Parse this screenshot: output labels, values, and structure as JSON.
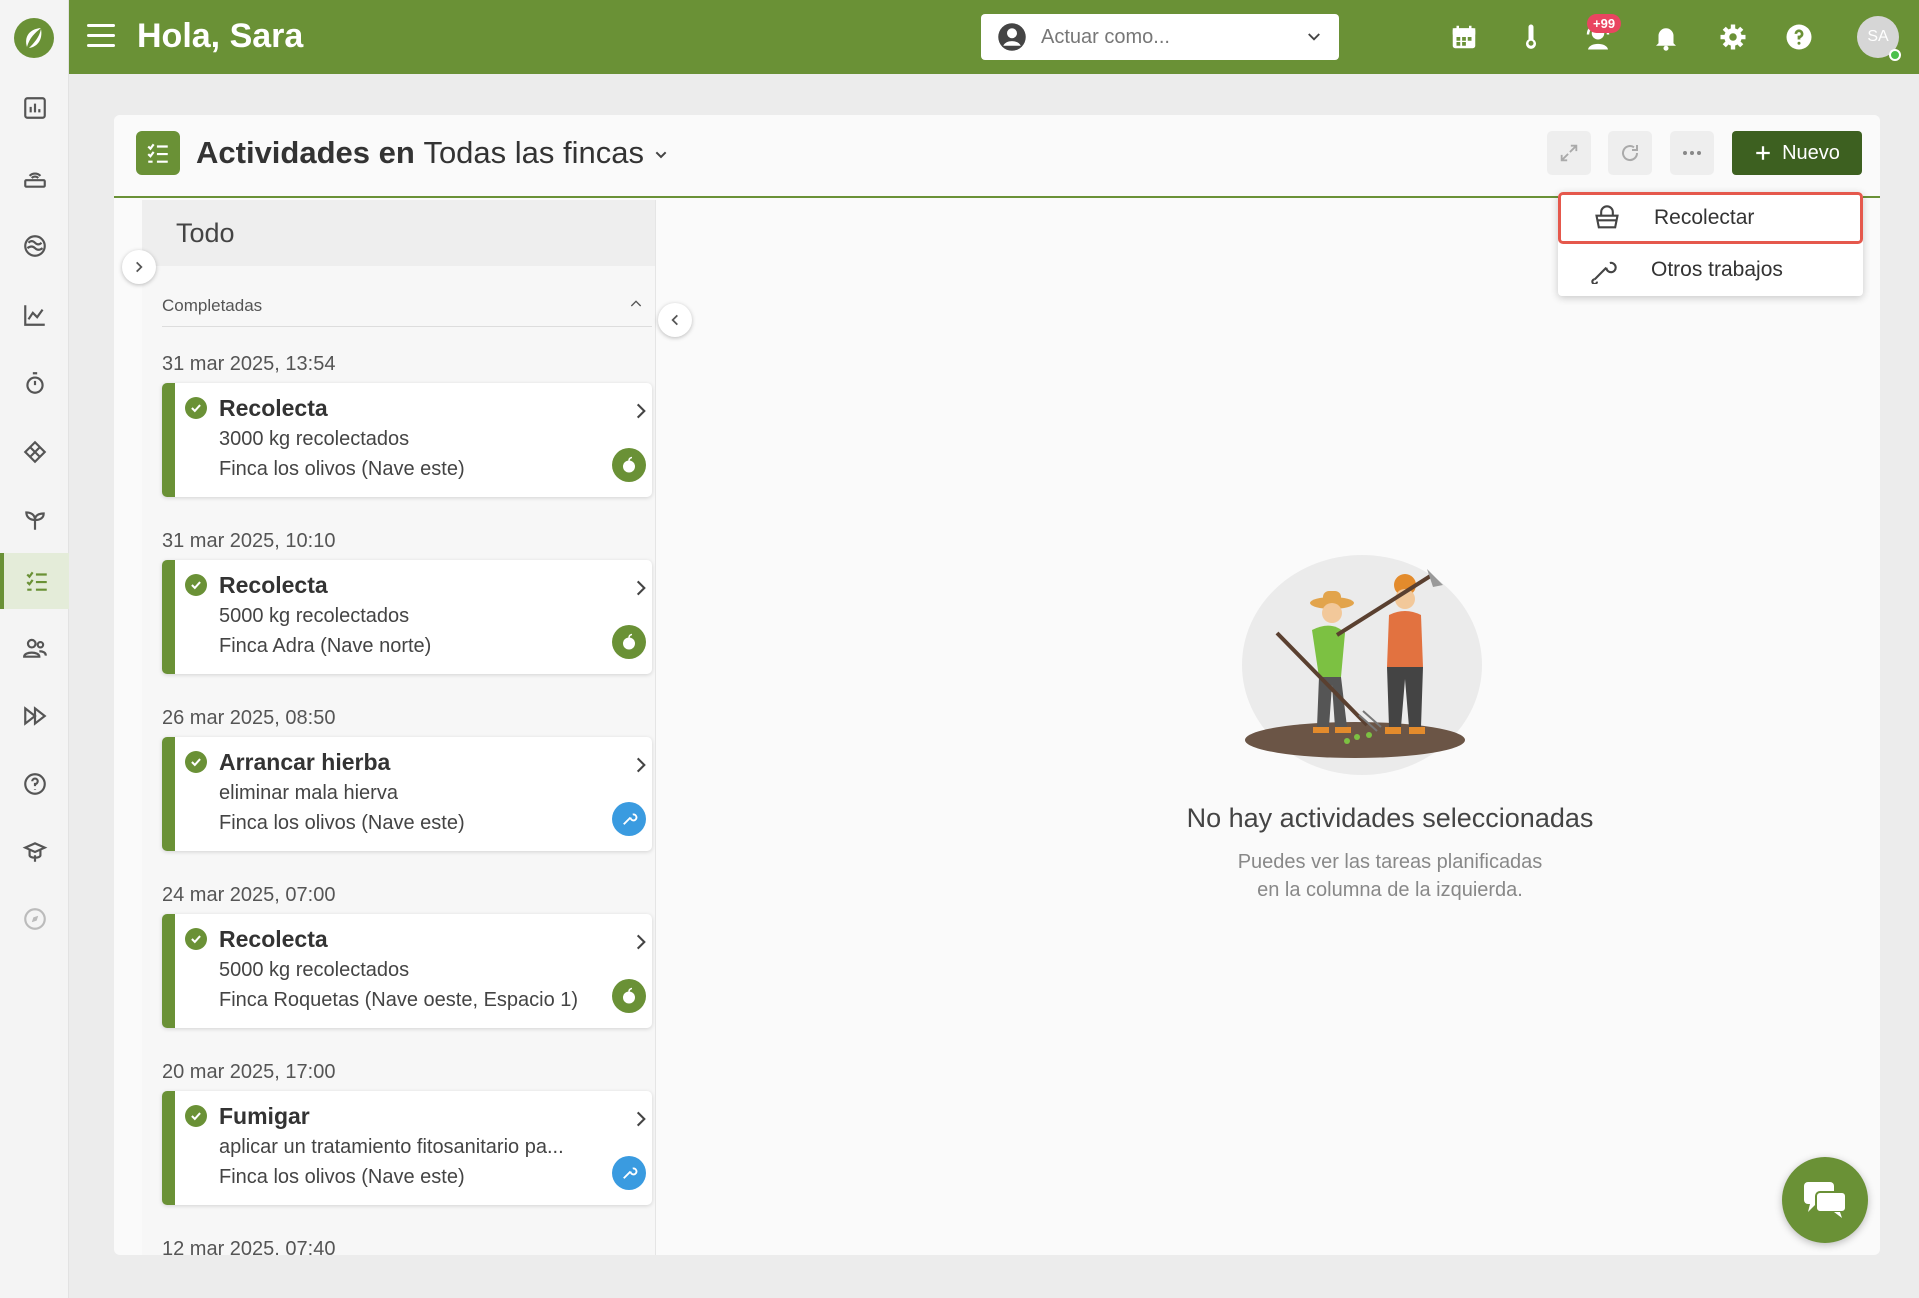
{
  "app": {
    "greeting": "Hola, Sara",
    "act_as_placeholder": "Actuar como...",
    "notification_badge": "+99",
    "avatar_initials": "SA"
  },
  "colors": {
    "brand": "#6a9136",
    "dark_button": "#3d6020",
    "badge": "#e94560",
    "highlight_border": "#e5584c",
    "work_icon": "#3a9be0"
  },
  "sidebar": {
    "items": [
      {
        "name": "dashboard-icon"
      },
      {
        "name": "sensors-icon"
      },
      {
        "name": "weather-icon"
      },
      {
        "name": "chart-icon"
      },
      {
        "name": "timer-icon"
      },
      {
        "name": "layers-icon"
      },
      {
        "name": "plant-icon"
      },
      {
        "name": "activities-icon",
        "active": true
      },
      {
        "name": "users-icon"
      },
      {
        "name": "fast-forward-icon"
      },
      {
        "name": "help-icon"
      },
      {
        "name": "academy-icon"
      },
      {
        "name": "compass-icon"
      }
    ]
  },
  "panel": {
    "title": "Actividades en",
    "scope": "Todas las fincas",
    "new_button": "Nuevo"
  },
  "list": {
    "tab": "Todo",
    "section": "Completadas",
    "entries": [
      {
        "date": "31 mar 2025, 13:54",
        "title": "Recolecta",
        "sub": "3000 kg recolectados",
        "loc": "Finca los olivos (Nave este)",
        "kind": "harvest"
      },
      {
        "date": "31 mar 2025, 10:10",
        "title": "Recolecta",
        "sub": "5000 kg recolectados",
        "loc": "Finca Adra (Nave norte)",
        "kind": "harvest"
      },
      {
        "date": "26 mar 2025, 08:50",
        "title": "Arrancar hierba",
        "sub": "eliminar mala hierva",
        "loc": "Finca los olivos (Nave este)",
        "kind": "work"
      },
      {
        "date": "24 mar 2025, 07:00",
        "title": "Recolecta",
        "sub": "5000 kg recolectados",
        "loc": "Finca Roquetas (Nave oeste, Espacio 1)",
        "kind": "harvest"
      },
      {
        "date": "20 mar 2025, 17:00",
        "title": "Fumigar",
        "sub": "aplicar un tratamiento fitosanitario pa...",
        "loc": "Finca los olivos (Nave este)",
        "kind": "work"
      }
    ],
    "trailing_date": "12 mar 2025, 07:40"
  },
  "empty_state": {
    "title": "No hay actividades seleccionadas",
    "line1": "Puedes ver las tareas planificadas",
    "line2": "en la columna de la izquierda."
  },
  "menu": {
    "items": [
      {
        "label": "Recolectar",
        "icon": "basket-icon"
      },
      {
        "label": "Otros trabajos",
        "icon": "tools-icon"
      }
    ]
  }
}
